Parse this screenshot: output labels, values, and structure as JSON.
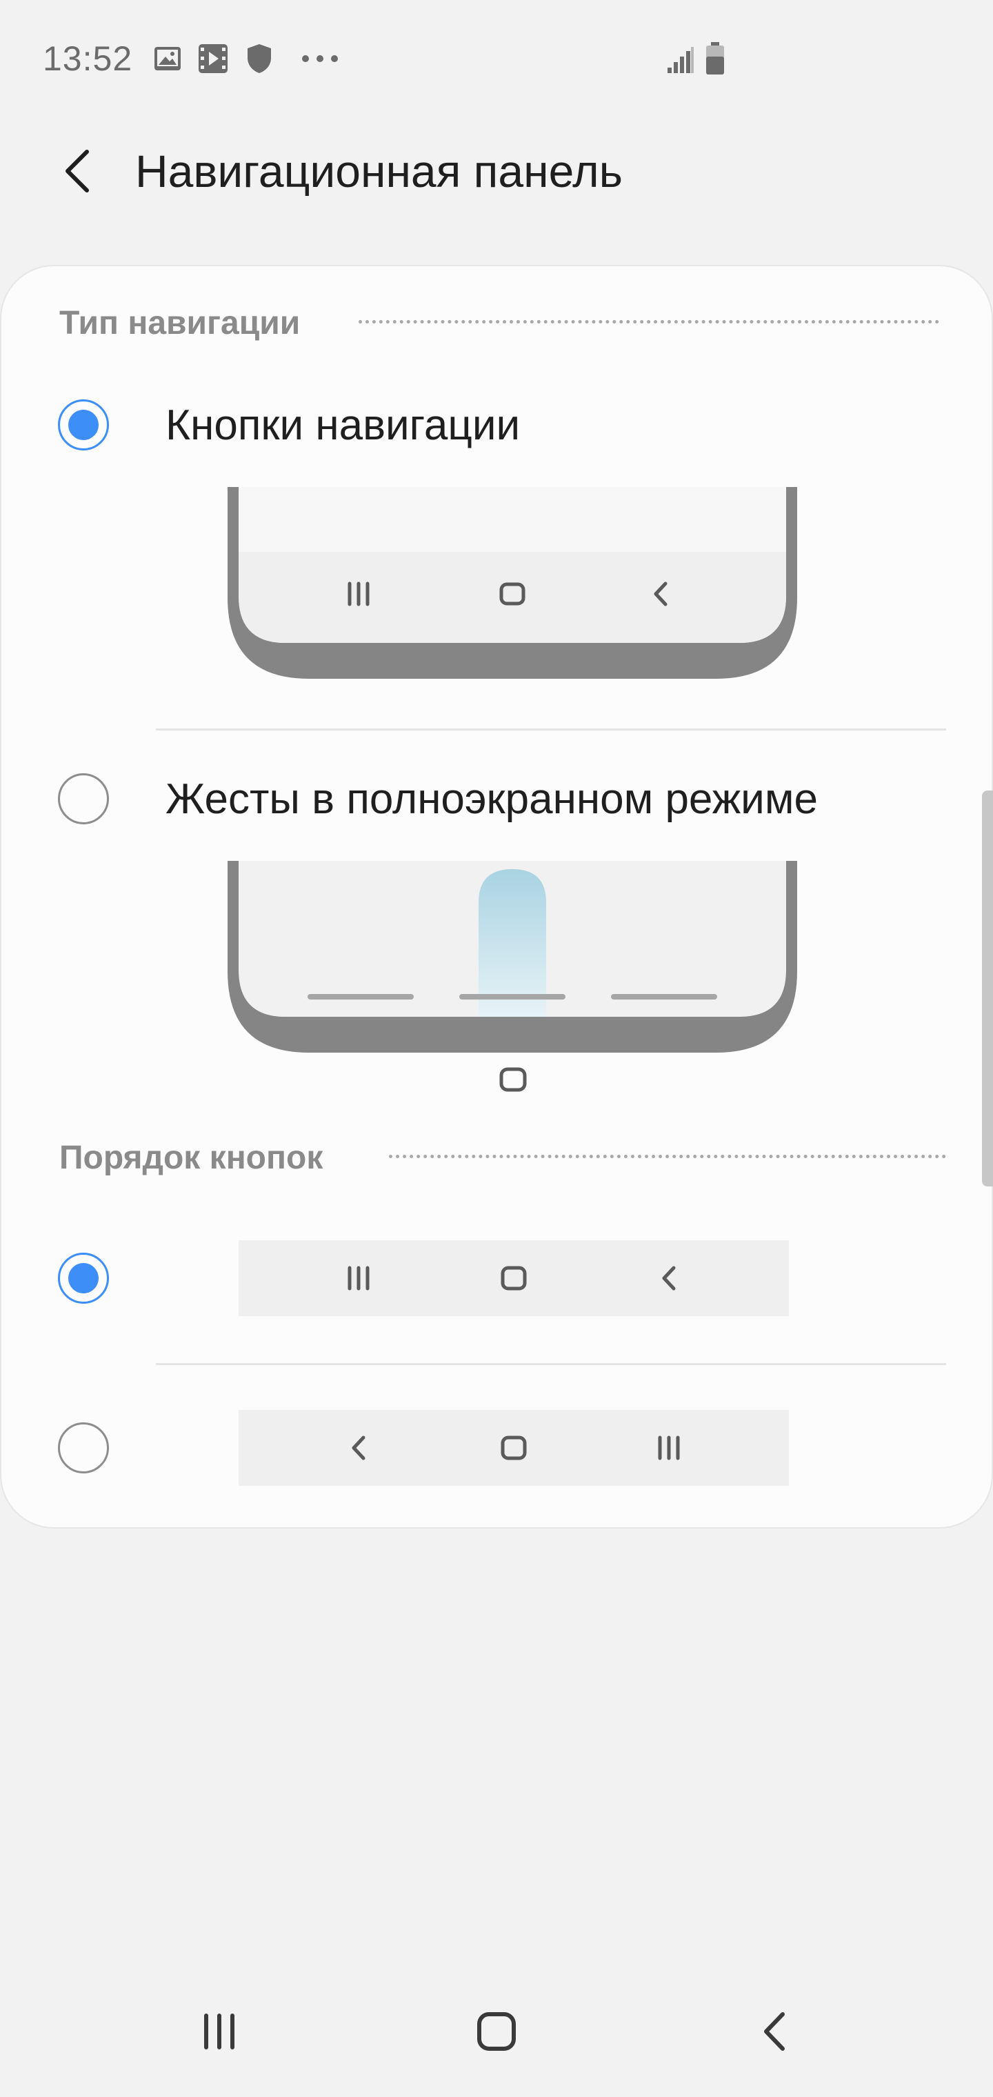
{
  "status_bar": {
    "time": "13:52",
    "icons": [
      "image-icon",
      "video-icon",
      "shield-icon",
      "more-dots-icon",
      "signal-icon",
      "battery-icon"
    ]
  },
  "header": {
    "title": "Навигационная панель",
    "back_icon": "chevron-left-icon"
  },
  "navigation_type": {
    "section_title": "Тип навигации",
    "options": [
      {
        "label": "Кнопки навигации",
        "selected": true
      },
      {
        "label": "Жесты в полноэкранном режиме",
        "selected": false
      }
    ]
  },
  "button_order": {
    "section_title": "Порядок кнопок",
    "options": [
      {
        "selected": true,
        "icons": [
          "recents-icon",
          "home-icon",
          "back-icon"
        ]
      },
      {
        "selected": false,
        "icons": [
          "back-icon",
          "home-icon",
          "recents-icon"
        ]
      }
    ]
  },
  "bottom_nav": {
    "icons": [
      "recents-icon",
      "home-icon",
      "back-icon"
    ]
  },
  "colors": {
    "accent": "#3e8ef7",
    "background": "#f2f2f2",
    "card": "#fcfcfc",
    "section_title": "#8a8a8a",
    "gesture_hint": "#a9d3e2"
  }
}
